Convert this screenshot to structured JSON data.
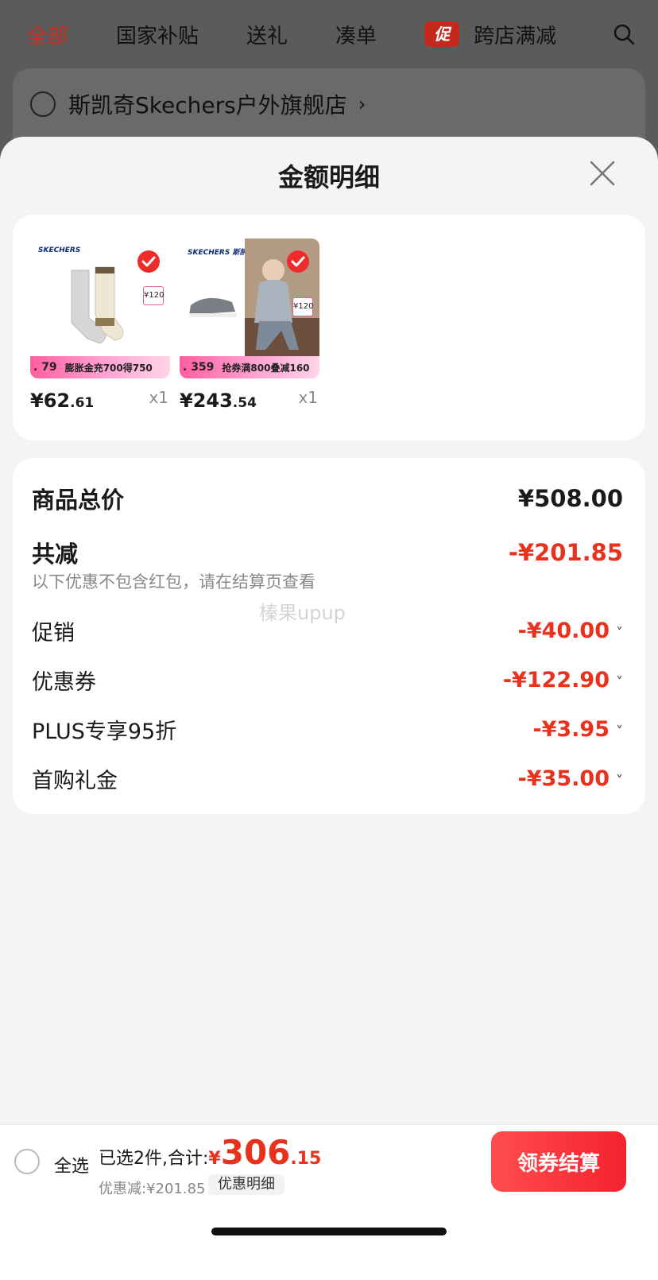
{
  "background": {
    "tabs": [
      "全部",
      "国家补贴",
      "送礼",
      "凑单",
      "跨店满减"
    ],
    "promo_badge": "促",
    "store_name": "斯凯奇Skechers户外旗舰店",
    "store_arrow": "›"
  },
  "sheet": {
    "title": "金额明细",
    "products": [
      {
        "brand": "SKECHERS",
        "sticker": "¥120",
        "strip_price": ". 79",
        "strip_text": "膨胀金充700得750",
        "price_main": "¥62",
        "price_decimal": ".61",
        "qty": "x1"
      },
      {
        "brand": "SKECHERS 斯凯奇",
        "sticker": "¥120",
        "strip_price": ". 359",
        "strip_text": "抢券满800叠减160",
        "price_main": "¥243",
        "price_decimal": ".54",
        "qty": "x1"
      }
    ],
    "total_label": "商品总价",
    "total_value": "¥508.00",
    "reduce_label": "共减",
    "reduce_value": "-¥201.85",
    "note": "以下优惠不包含红包，请在结算页查看",
    "watermark": "榛果upup",
    "items": [
      {
        "label": "促销",
        "value": "-¥40.00"
      },
      {
        "label": "优惠券",
        "value": "-¥122.90"
      },
      {
        "label": "PLUS专享95折",
        "value": "-¥3.95"
      },
      {
        "label": "首购礼金",
        "value": "-¥35.00"
      }
    ],
    "chevron": "˅"
  },
  "bottom": {
    "select_all": "全选",
    "selected_text": "已选2件,合计:",
    "currency": "¥",
    "amount_main": "306",
    "amount_decimal": ".15",
    "discount_text": "优惠减:¥201.85",
    "detail_tag": "优惠明细",
    "checkout": "领券结算"
  },
  "colors": {
    "accent_red": "#e8321e",
    "checkout_gradient_start": "#ff4d4d",
    "checkout_gradient_end": "#f5222d",
    "active_tab": "#c9301d"
  }
}
